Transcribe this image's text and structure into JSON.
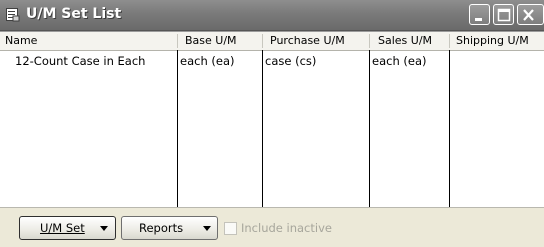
{
  "window": {
    "title": "U/M Set List"
  },
  "columns": [
    "Name",
    "Base U/M",
    "Purchase U/M",
    "Sales U/M",
    "Shipping U/M"
  ],
  "rows": [
    {
      "name": "12-Count Case in Each",
      "base": "each (ea)",
      "purchase": "case (cs)",
      "sales": "each (ea)",
      "shipping": ""
    }
  ],
  "footer": {
    "um_set_button": "U/M Set",
    "reports_button": "Reports",
    "include_inactive_label": "Include inactive",
    "include_inactive_checked": false
  },
  "icons": {
    "title": "list-window-icon",
    "minimize": "minimize-icon",
    "maximize": "maximize-icon",
    "close": "close-icon",
    "dropdown": "chevron-down-icon"
  },
  "colors": {
    "titlebar": "#7a7a7a",
    "window_bg": "#ece9d8",
    "disabled_text": "#a7a69c"
  }
}
